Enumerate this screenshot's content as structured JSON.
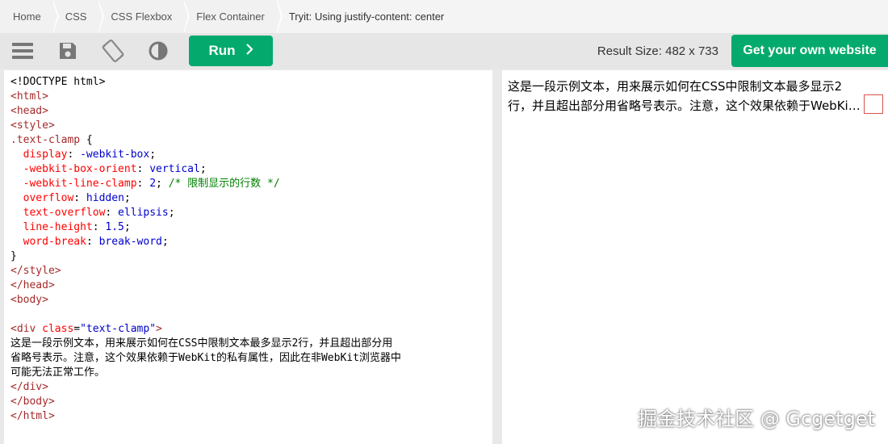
{
  "breadcrumb": {
    "items": [
      "Home",
      "CSS",
      "CSS Flexbox",
      "Flex Container"
    ],
    "current": "Tryit: Using justify-content: center"
  },
  "toolbar": {
    "icons": [
      "menu-icon",
      "save-icon",
      "rotate-icon",
      "contrast-icon"
    ],
    "run_label": "Run",
    "run_icon": "chevron-right-icon",
    "result_size": "Result Size: 482 x 733",
    "get_site_label": "Get your own website",
    "accent_color": "#04aa6d"
  },
  "code": {
    "lines": [
      "<!DOCTYPE html>",
      "<html>",
      "<head>",
      "<style>",
      ".text-clamp {",
      "  display: -webkit-box;",
      "  -webkit-box-orient: vertical;",
      "  -webkit-line-clamp: 2; /* 限制显示的行数 */",
      "  overflow: hidden;",
      "  text-overflow: ellipsis;",
      "  line-height: 1.5;",
      "  word-break: break-word;",
      "}",
      "</style>",
      "</head>",
      "<body>",
      "",
      "<div class=\"text-clamp\">",
      "这是一段示例文本，用来展示如何在CSS中限制文本最多显示2行，并且超出部分用",
      "省略号表示。注意，这个效果依赖于WebKit的私有属性，因此在非WebKit浏览器中",
      "可能无法正常工作。",
      "</div>",
      "</body>",
      "</html>"
    ]
  },
  "result": {
    "line1": "这是一段示例文本，用来展示如何在CSS中限制文本最多显示2",
    "line2": "行，并且超出部分用省略号表示。注意，这个效果依赖于WebKi…",
    "watermark": "掘金技术社区 @ Gcgetget"
  }
}
